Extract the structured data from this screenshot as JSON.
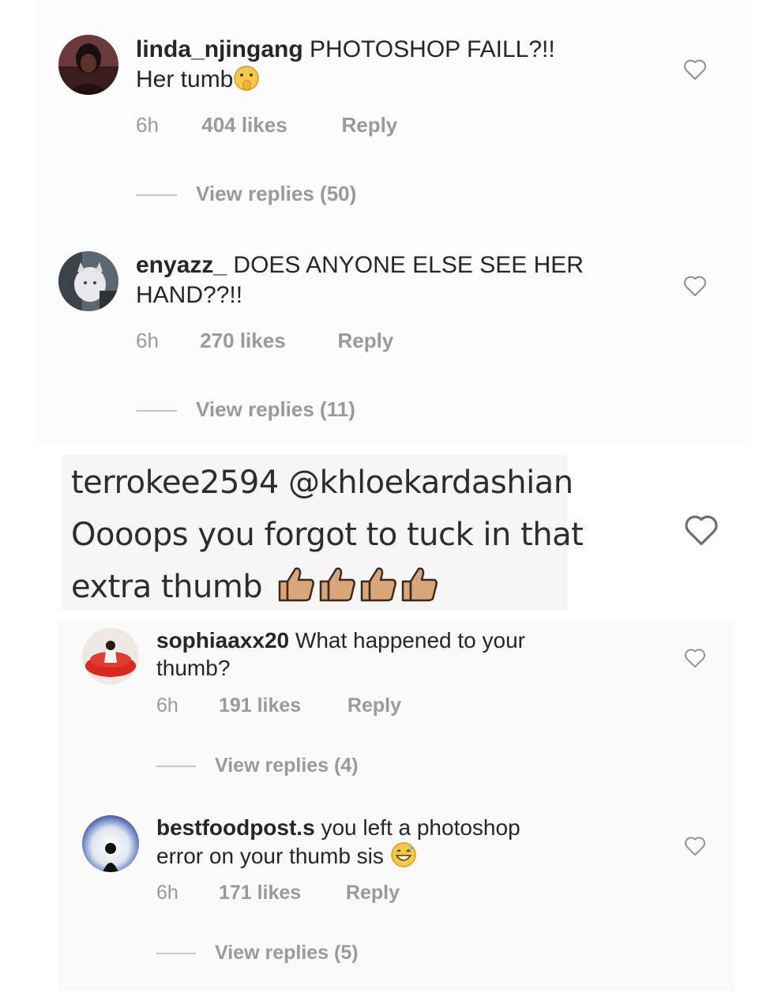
{
  "comments": [
    {
      "username": "linda_njingang",
      "text_line1": "PHOTOSHOP FAILL?!!",
      "text_line2": "Her tumb",
      "emoji": "shushing-face",
      "time": "6h",
      "likes": "404 likes",
      "reply": "Reply",
      "view_replies": "View replies (50)"
    },
    {
      "username": "enyazz_",
      "text_line1": "DOES ANYONE ELSE SEE HER",
      "text_line2": "HAND??!!",
      "time": "6h",
      "likes": "270 likes",
      "reply": "Reply",
      "view_replies": "View replies (11)"
    },
    {
      "username": "terrokee2594",
      "mention": "@khloekardashian",
      "text_line2": "Oooops you forgot to tuck in that",
      "text_line3": "extra thumb",
      "emoji": "thumbs-up x4"
    },
    {
      "username": "sophiaaxx20",
      "text_line1": "What happened to your",
      "text_line2": "thumb?",
      "time": "6h",
      "likes": "191 likes",
      "reply": "Reply",
      "view_replies": "View replies (4)"
    },
    {
      "username": "bestfoodpost.s",
      "text_line1": "you left a photoshop",
      "text_line2": "error on your thumb sis",
      "emoji": "grinning-sweat-face",
      "time": "6h",
      "likes": "171 likes",
      "reply": "Reply",
      "view_replies": "View replies (5)"
    }
  ],
  "icons": {
    "like": "heart-outline-icon"
  },
  "colors": {
    "text": "#262626",
    "meta": "#9a9a9a",
    "emoji_skin": "#d9a679"
  }
}
